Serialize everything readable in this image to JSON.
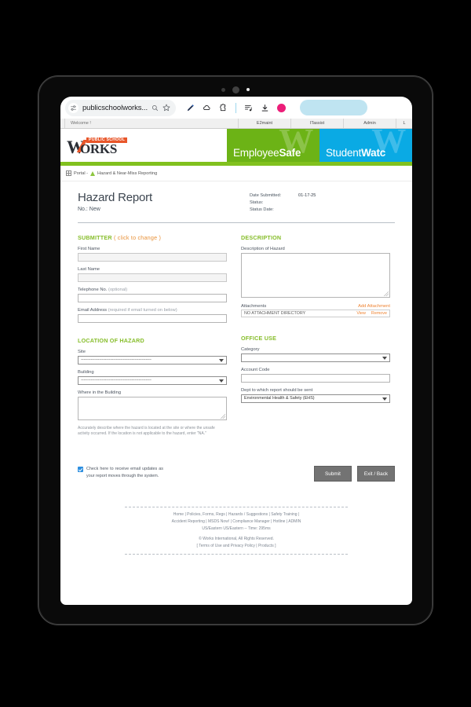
{
  "browser": {
    "url": "publicschoolworks...",
    "page_info_icon": "page-settings-icon",
    "search_icon": "search-icon",
    "bookmark_icon": "star-icon",
    "actions": [
      {
        "name": "pen-icon"
      },
      {
        "name": "cloud-icon"
      },
      {
        "name": "extensions-icon"
      },
      {
        "name": "reading-list-icon"
      },
      {
        "name": "download-icon"
      },
      {
        "name": "profile-avatar-icon"
      }
    ]
  },
  "site_topbar": {
    "welcome": "Welcome !",
    "tabs": [
      {
        "label": "E2maint"
      },
      {
        "label": "ITassist"
      },
      {
        "label": "Admin"
      },
      {
        "label": "L"
      }
    ]
  },
  "brand": {
    "logo_w": "W",
    "logo_orks": "ORKS",
    "logo_tagline": "PUBLIC SCHOOL",
    "ghost_letter": "W",
    "panels": [
      {
        "light": "Employee",
        "bold": "Safe",
        "color": "#6cb316"
      },
      {
        "light": "Student",
        "bold": "Watc",
        "color": "#0aaae4"
      }
    ]
  },
  "breadcrumb": {
    "portal": "Portal -",
    "current": "Hazard & Near-Miss Reporting"
  },
  "report": {
    "title": "Hazard Report",
    "no_label": "No.:",
    "no_value": "New",
    "meta": [
      {
        "label": "Date Submitted:",
        "value": "01-17-25"
      },
      {
        "label": "Status:",
        "value": ""
      },
      {
        "label": "Status Date:",
        "value": ""
      }
    ]
  },
  "submitter": {
    "title": "SUBMITTER",
    "title_hint": "( click to change )",
    "first_name_label": "First Name",
    "first_name_value": "",
    "last_name_label": "Last Name",
    "last_name_value": "",
    "telephone_label": "Telephone No.",
    "telephone_sub": "(optional)",
    "telephone_value": "",
    "email_label": "Email Address",
    "email_sub": "(required if email turned on below)",
    "email_value": ""
  },
  "description": {
    "title": "DESCRIPTION",
    "hazard_label": "Description of Hazard",
    "hazard_value": "",
    "attachments_label": "Attachments",
    "add_attachment_label": "Add Attachment",
    "attachment_row_text": "NO ATTACHMENT DIRECTORY",
    "view_label": "View",
    "remove_label": "Remove"
  },
  "location": {
    "title": "LOCATION OF HAZARD",
    "site_label": "Site",
    "site_value": "--------------------------------------------------",
    "building_label": "Building",
    "building_value": "--------------------------------------------------",
    "where_label": "Where in the Building",
    "where_value": "",
    "help_text": "Accurately describe where the hazard is located at the site or where the unsafe activity occurred. If the location is not applicable to the hazard, enter \"NA.\""
  },
  "office_use": {
    "title": "OFFICE USE",
    "category_label": "Category",
    "category_value": "",
    "account_code_label": "Account Code",
    "account_code_value": "",
    "dept_label": "Dept to which report should be sent",
    "dept_value": "Environmental Health & Safety (EHS)"
  },
  "actions": {
    "email_optin_text": "Check here to receive email updates as your report moves through the system.",
    "email_optin_checked": true,
    "submit_label": "Submit",
    "exit_label": "Exit / Back"
  },
  "footer": {
    "links_line_1": "Home | Policies, Forms, Regs | Hazards / Suggestions | Safety Training |",
    "links_line_2": "Accident Reporting | MSDS Now! | Compliance Manager | Hotline | ADMIN",
    "timing_line": "US/Eastern US/Eastern -- Time: 295ms",
    "copyright": "© Works International, All Rights Reserved.",
    "terms": "[ Terms of Use and Privacy Policy | Products ]"
  }
}
